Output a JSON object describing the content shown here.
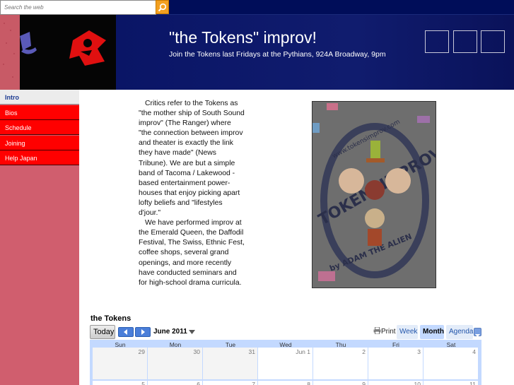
{
  "search": {
    "placeholder": "Search the web"
  },
  "header": {
    "title": "\"the Tokens\" improv!",
    "tagline": "Join the Tokens last Fridays at the Pythians, 924A Broadway, 9pm"
  },
  "nav": {
    "items": [
      {
        "label": "Intro"
      },
      {
        "label": "Bios"
      },
      {
        "label": "Schedule"
      },
      {
        "label": "Joining"
      },
      {
        "label": "Help Japan"
      }
    ]
  },
  "intro": {
    "p1": "Critics refer to the Tokens as \"the mother ship of South Sound improv\" (The Ranger) where \"the connection between improv and theater is exactly the link they have made\" (News Tribune). We are but a simple band of Tacoma / Lakewood -based entertainment power-houses that enjoy picking apart lofty beliefs and \"lifestyles d'jour.\"",
    "p2": "We have performed improv at the Emerald Queen, the Daffodil Festival, The Swiss, Ethnic Fest, coffee shops, several grand openings, and more recently have conducted seminars and for high-school drama curricula."
  },
  "photo": {
    "top_text": "www.tokensimprov.com",
    "ring_text": "TOKENSIMPROV",
    "bottom_text": "by ADAM THE ALIEN"
  },
  "calendar": {
    "title": "the Tokens",
    "today_label": "Today",
    "month_label": "June 2011",
    "print_label": "Print",
    "views": {
      "week": "Week",
      "month": "Month",
      "agenda": "Agenda"
    },
    "day_headers": [
      "Sun",
      "Mon",
      "Tue",
      "Wed",
      "Thu",
      "Fri",
      "Sat"
    ],
    "week1": [
      "29",
      "30",
      "31",
      "Jun 1",
      "2",
      "3",
      "4"
    ],
    "week2": [
      "5",
      "6",
      "7",
      "8",
      "9",
      "10",
      "11"
    ]
  },
  "colors": {
    "header_bg": "#000c50",
    "nav_red": "#ff0000",
    "sidebar": "#d05e6e",
    "calendar_blue": "#c3d9ff",
    "search_button": "#f3a020"
  }
}
